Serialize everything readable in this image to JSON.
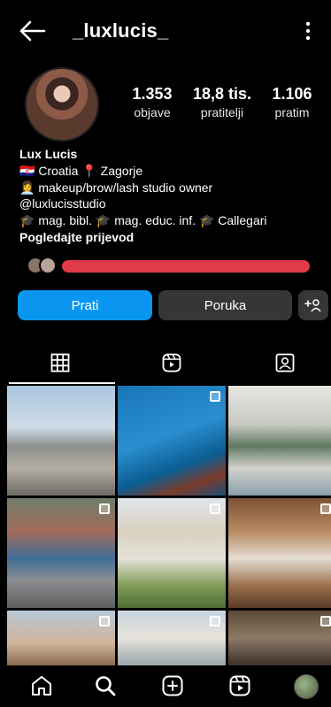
{
  "header": {
    "username": "_luxlucis_"
  },
  "stats": [
    {
      "value": "1.353",
      "label": "objave"
    },
    {
      "value": "18,8 tis.",
      "label": "pratitelji"
    },
    {
      "value": "1.106",
      "label": "pratim"
    }
  ],
  "bio": {
    "name": "Lux Lucis",
    "line1": "🇭🇷 Croatia 📍 Zagorje",
    "line2": "👩‍💼 makeup/brow/lash studio owner",
    "line3": "@luxlucisstudio",
    "line4": "🎓 mag. bibl. 🎓 mag. educ. inf. 🎓 Callegari",
    "translate": "Pogledajte prijevod"
  },
  "buttons": {
    "follow": "Prati",
    "message": "Poruka"
  },
  "colors": {
    "follow_blue": "#0a95f0",
    "button_gray": "#363636",
    "redaction": "#e0394a"
  },
  "icons": {
    "header": [
      "back-arrow-icon",
      "more-vertical-icon"
    ],
    "tabs": [
      "grid-icon",
      "reels-icon",
      "tagged-icon"
    ],
    "nav": [
      "home-icon",
      "search-icon",
      "create-icon",
      "reels-icon",
      "profile-avatar"
    ]
  }
}
